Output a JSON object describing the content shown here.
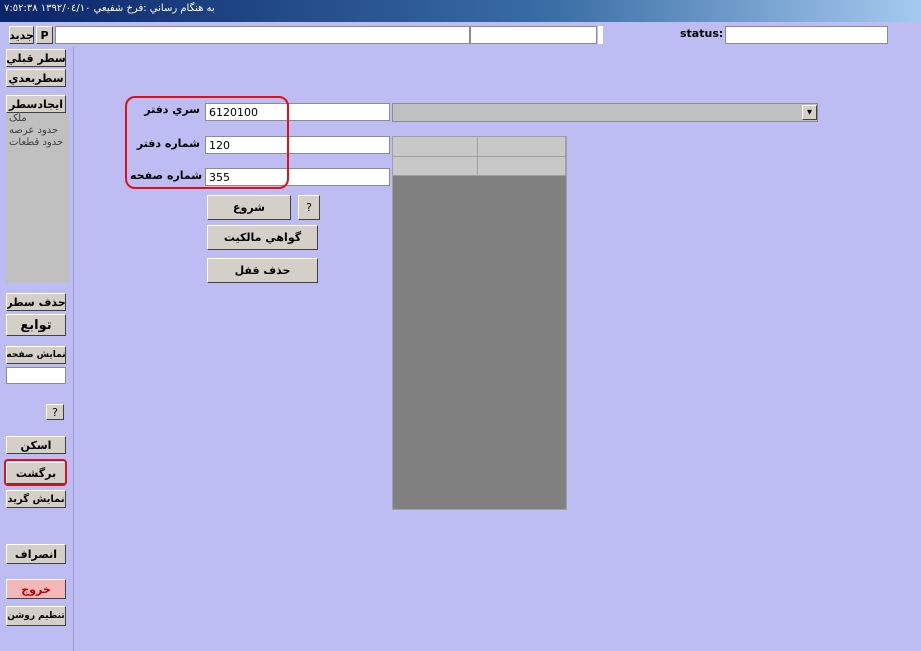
{
  "window": {
    "title": "به هنگام رساني :فرخ شفيعي ١٣٩٢/٠٤/١٠ ٧:٥٢:٣٨"
  },
  "toolbar": {
    "new_label": "جديد",
    "p_label": "P",
    "status_label": "status:"
  },
  "sidebar": {
    "prev_row": "سطر قبلي",
    "next_row": "سطربعدي",
    "create_row": "ايجادسطر",
    "list_items": [
      "ملک",
      "حدود عرصه",
      "حدود قطعات"
    ],
    "delete_row": "حذف سطر",
    "functions": "توابع",
    "show_page": "نمايش صفحه",
    "help": "?",
    "scan": "اسکن",
    "return": "برگشت",
    "show_grid": "نمايش گريد",
    "cancel": "انصراف",
    "exit": "خروج",
    "brightness": "تنظيم روشن"
  },
  "form": {
    "series_label": "سري دفتر",
    "series_value": "6120100",
    "book_label": "شماره دفتر",
    "book_value": "120",
    "page_label": "شماره صفحه",
    "page_value": "355",
    "start_button": "شروع",
    "help_button": "?",
    "certificate_button": "گواهي مالکيت",
    "unlock_button": "حذف قفل",
    "dropdown_arrow": "▾"
  },
  "colors": {
    "background": "#bdbdf3",
    "highlight": "#e0101a",
    "exit_button": "#f4b8b8"
  }
}
